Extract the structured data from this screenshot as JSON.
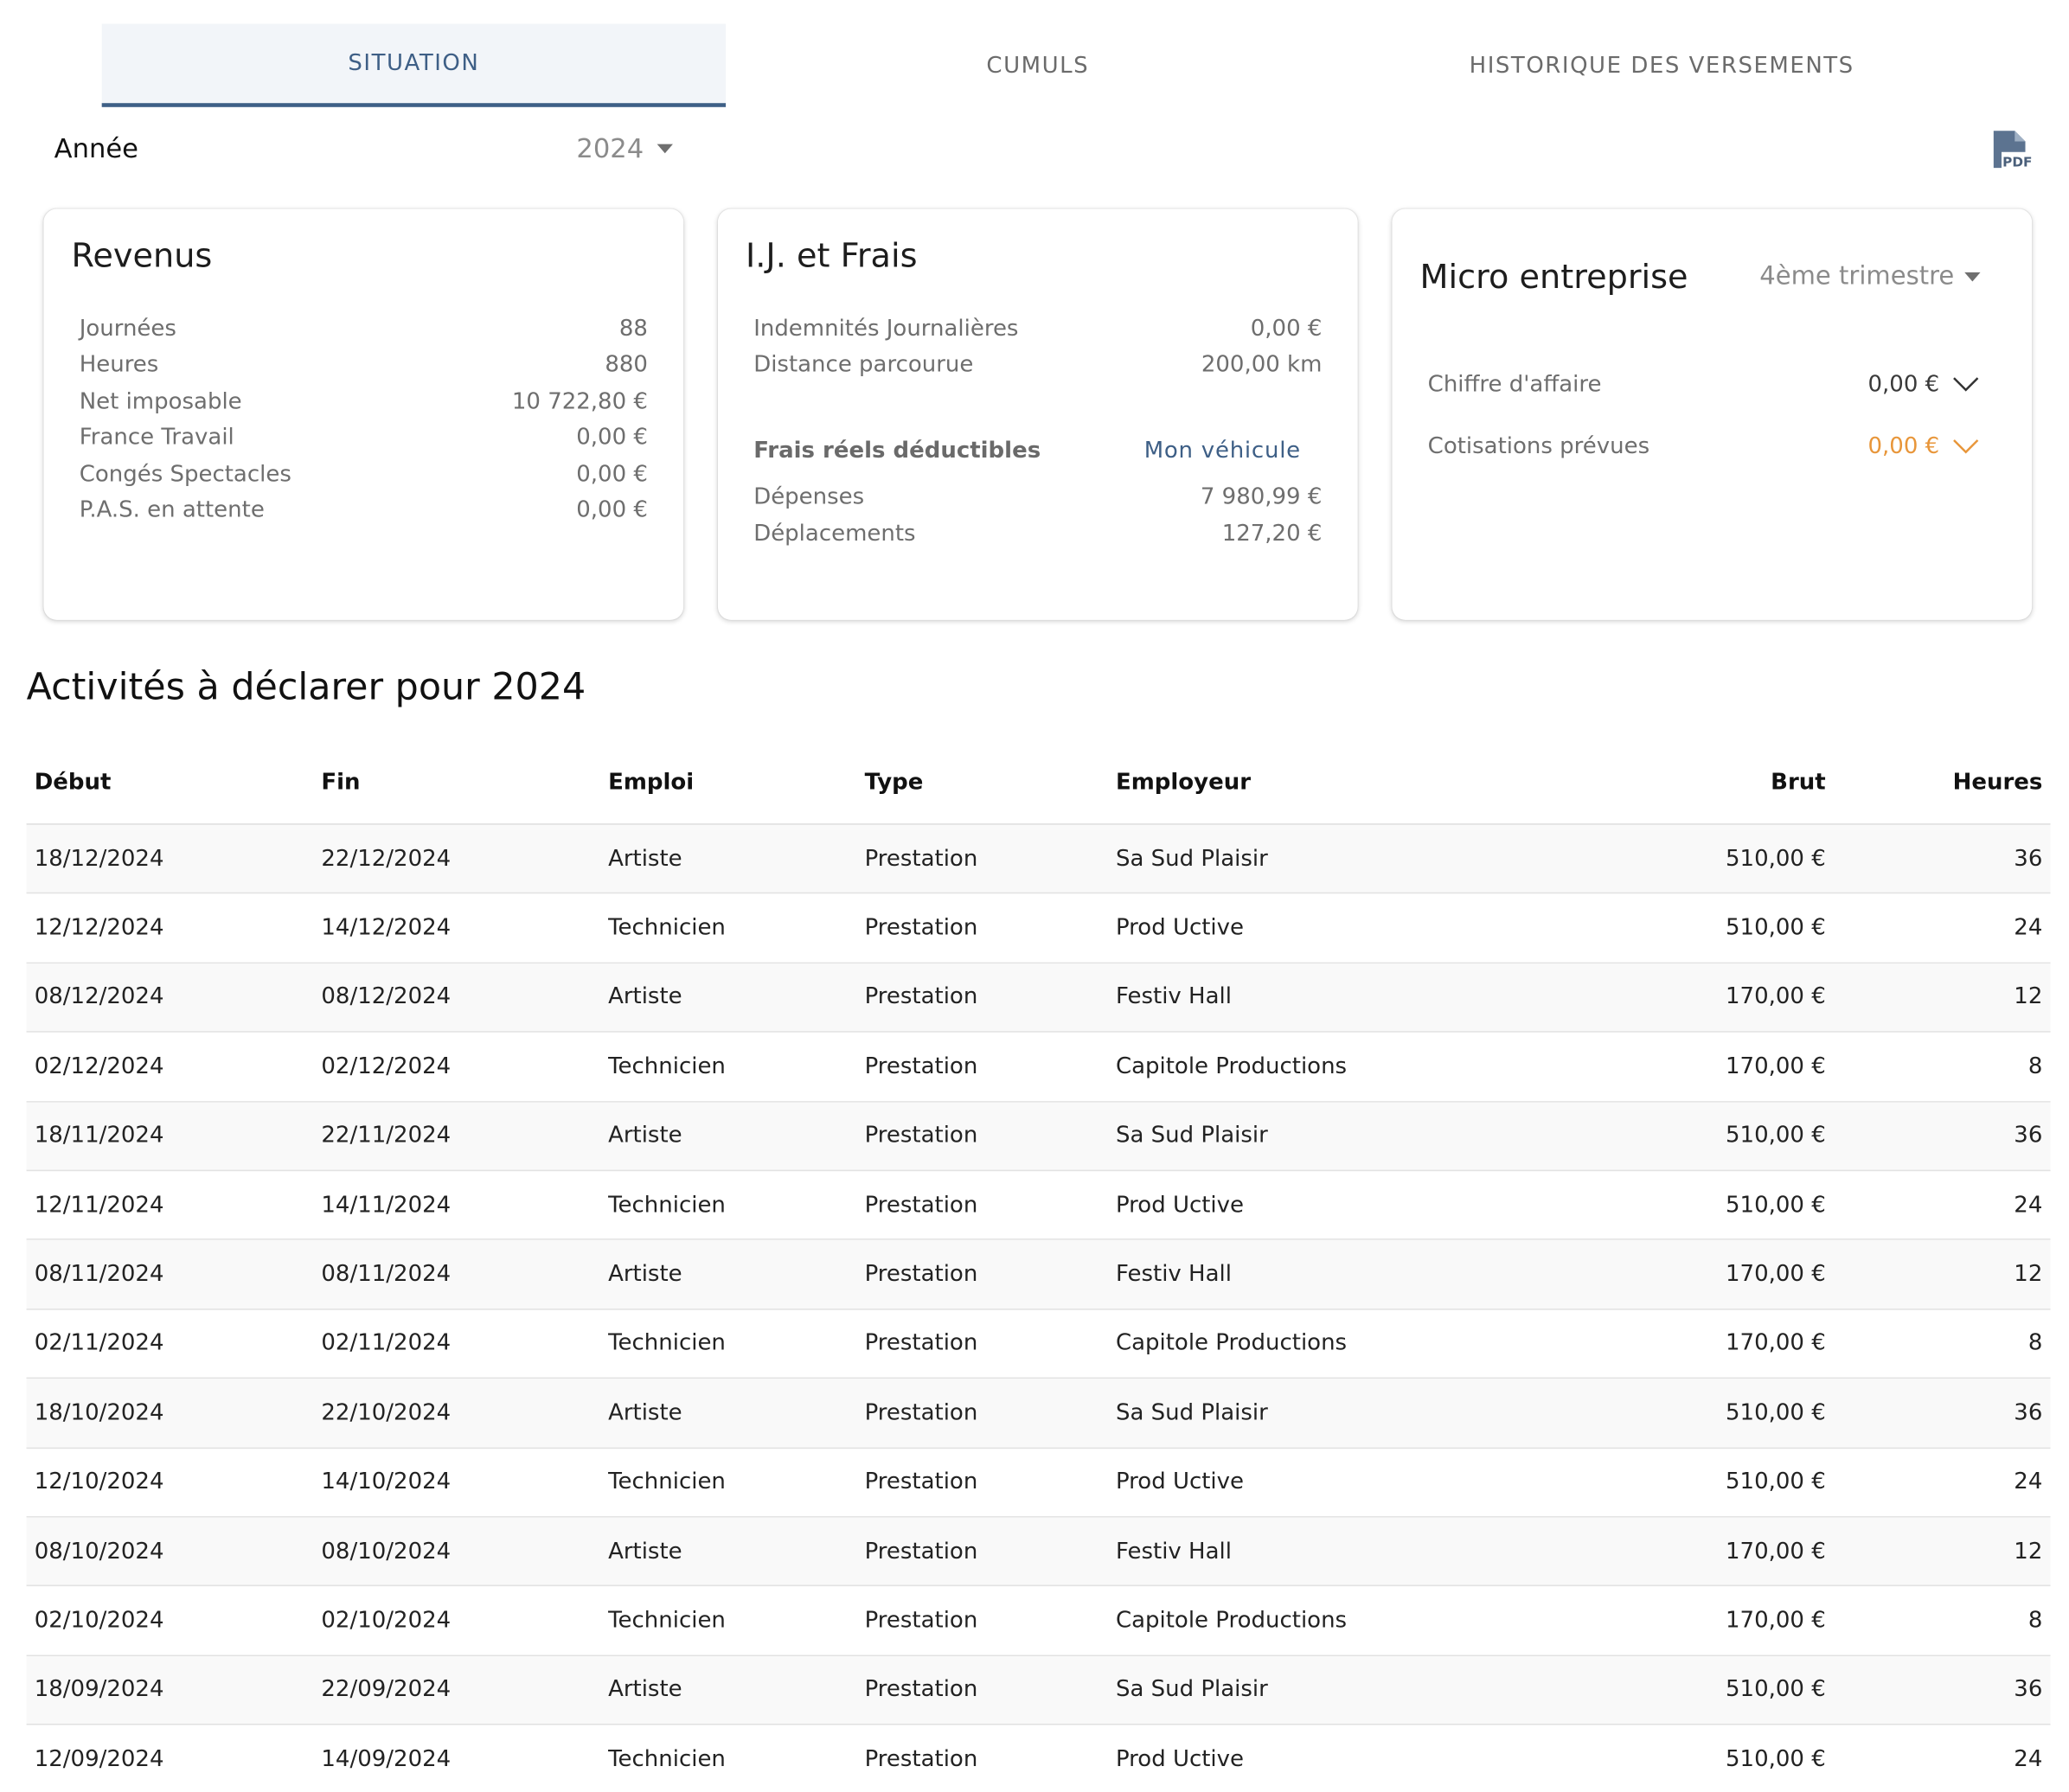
{
  "tabs": [
    {
      "label": "SITUATION",
      "active": true
    },
    {
      "label": "CUMULS",
      "active": false
    },
    {
      "label": "HISTORIQUE DES VERSEMENTS",
      "active": false
    }
  ],
  "year": {
    "label": "Année",
    "value": "2024"
  },
  "icons": {
    "pdf": "pdf-file-icon",
    "year_caret": "caret-down-icon",
    "expand": "chevron-down-icon"
  },
  "revenus": {
    "title": "Revenus",
    "rows": [
      {
        "label": "Journées",
        "value": "88"
      },
      {
        "label": "Heures",
        "value": "880"
      },
      {
        "label": "Net imposable",
        "value": "10 722,80 €"
      },
      {
        "label": "France Travail",
        "value": "0,00 €"
      },
      {
        "label": "Congés Spectacles",
        "value": "0,00 €"
      },
      {
        "label": "P.A.S. en attente",
        "value": "0,00 €"
      }
    ]
  },
  "ij_frais": {
    "title": "I.J. et Frais",
    "rows": [
      {
        "label": "Indemnités Journalières",
        "value": "0,00 €"
      },
      {
        "label": "Distance parcourue",
        "value": "200,00 km"
      }
    ],
    "frais_label": "Frais réels déductibles",
    "vehicule_link": "Mon véhicule",
    "frais_rows": [
      {
        "label": "Dépenses",
        "value": "7 980,99 €"
      },
      {
        "label": "Déplacements",
        "value": "127,20 €"
      }
    ]
  },
  "micro": {
    "title": "Micro entreprise",
    "period": "4ème trimestre",
    "rows": [
      {
        "label": "Chiffre d'affaire",
        "value": "0,00 €",
        "color": "#3a3a3a"
      },
      {
        "label": "Cotisations prévues",
        "value": "0,00 €",
        "color": "#e8963a"
      }
    ]
  },
  "activities": {
    "title": "Activités à déclarer pour 2024",
    "columns": {
      "debut": "Début",
      "fin": "Fin",
      "emploi": "Emploi",
      "type": "Type",
      "employeur": "Employeur",
      "brut": "Brut",
      "heures": "Heures"
    },
    "rows": [
      {
        "debut": "18/12/2024",
        "fin": "22/12/2024",
        "emploi": "Artiste",
        "type": "Prestation",
        "employeur": "Sa Sud Plaisir",
        "brut": "510,00 €",
        "heures": "36"
      },
      {
        "debut": "12/12/2024",
        "fin": "14/12/2024",
        "emploi": "Technicien",
        "type": "Prestation",
        "employeur": "Prod Uctive",
        "brut": "510,00 €",
        "heures": "24"
      },
      {
        "debut": "08/12/2024",
        "fin": "08/12/2024",
        "emploi": "Artiste",
        "type": "Prestation",
        "employeur": "Festiv Hall",
        "brut": "170,00 €",
        "heures": "12"
      },
      {
        "debut": "02/12/2024",
        "fin": "02/12/2024",
        "emploi": "Technicien",
        "type": "Prestation",
        "employeur": "Capitole Productions",
        "brut": "170,00 €",
        "heures": "8"
      },
      {
        "debut": "18/11/2024",
        "fin": "22/11/2024",
        "emploi": "Artiste",
        "type": "Prestation",
        "employeur": "Sa Sud Plaisir",
        "brut": "510,00 €",
        "heures": "36"
      },
      {
        "debut": "12/11/2024",
        "fin": "14/11/2024",
        "emploi": "Technicien",
        "type": "Prestation",
        "employeur": "Prod Uctive",
        "brut": "510,00 €",
        "heures": "24"
      },
      {
        "debut": "08/11/2024",
        "fin": "08/11/2024",
        "emploi": "Artiste",
        "type": "Prestation",
        "employeur": "Festiv Hall",
        "brut": "170,00 €",
        "heures": "12"
      },
      {
        "debut": "02/11/2024",
        "fin": "02/11/2024",
        "emploi": "Technicien",
        "type": "Prestation",
        "employeur": "Capitole Productions",
        "brut": "170,00 €",
        "heures": "8"
      },
      {
        "debut": "18/10/2024",
        "fin": "22/10/2024",
        "emploi": "Artiste",
        "type": "Prestation",
        "employeur": "Sa Sud Plaisir",
        "brut": "510,00 €",
        "heures": "36"
      },
      {
        "debut": "12/10/2024",
        "fin": "14/10/2024",
        "emploi": "Technicien",
        "type": "Prestation",
        "employeur": "Prod Uctive",
        "brut": "510,00 €",
        "heures": "24"
      },
      {
        "debut": "08/10/2024",
        "fin": "08/10/2024",
        "emploi": "Artiste",
        "type": "Prestation",
        "employeur": "Festiv Hall",
        "brut": "170,00 €",
        "heures": "12"
      },
      {
        "debut": "02/10/2024",
        "fin": "02/10/2024",
        "emploi": "Technicien",
        "type": "Prestation",
        "employeur": "Capitole Productions",
        "brut": "170,00 €",
        "heures": "8"
      },
      {
        "debut": "18/09/2024",
        "fin": "22/09/2024",
        "emploi": "Artiste",
        "type": "Prestation",
        "employeur": "Sa Sud Plaisir",
        "brut": "510,00 €",
        "heures": "36"
      },
      {
        "debut": "12/09/2024",
        "fin": "14/09/2024",
        "emploi": "Technicien",
        "type": "Prestation",
        "employeur": "Prod Uctive",
        "brut": "510,00 €",
        "heures": "24"
      }
    ]
  }
}
